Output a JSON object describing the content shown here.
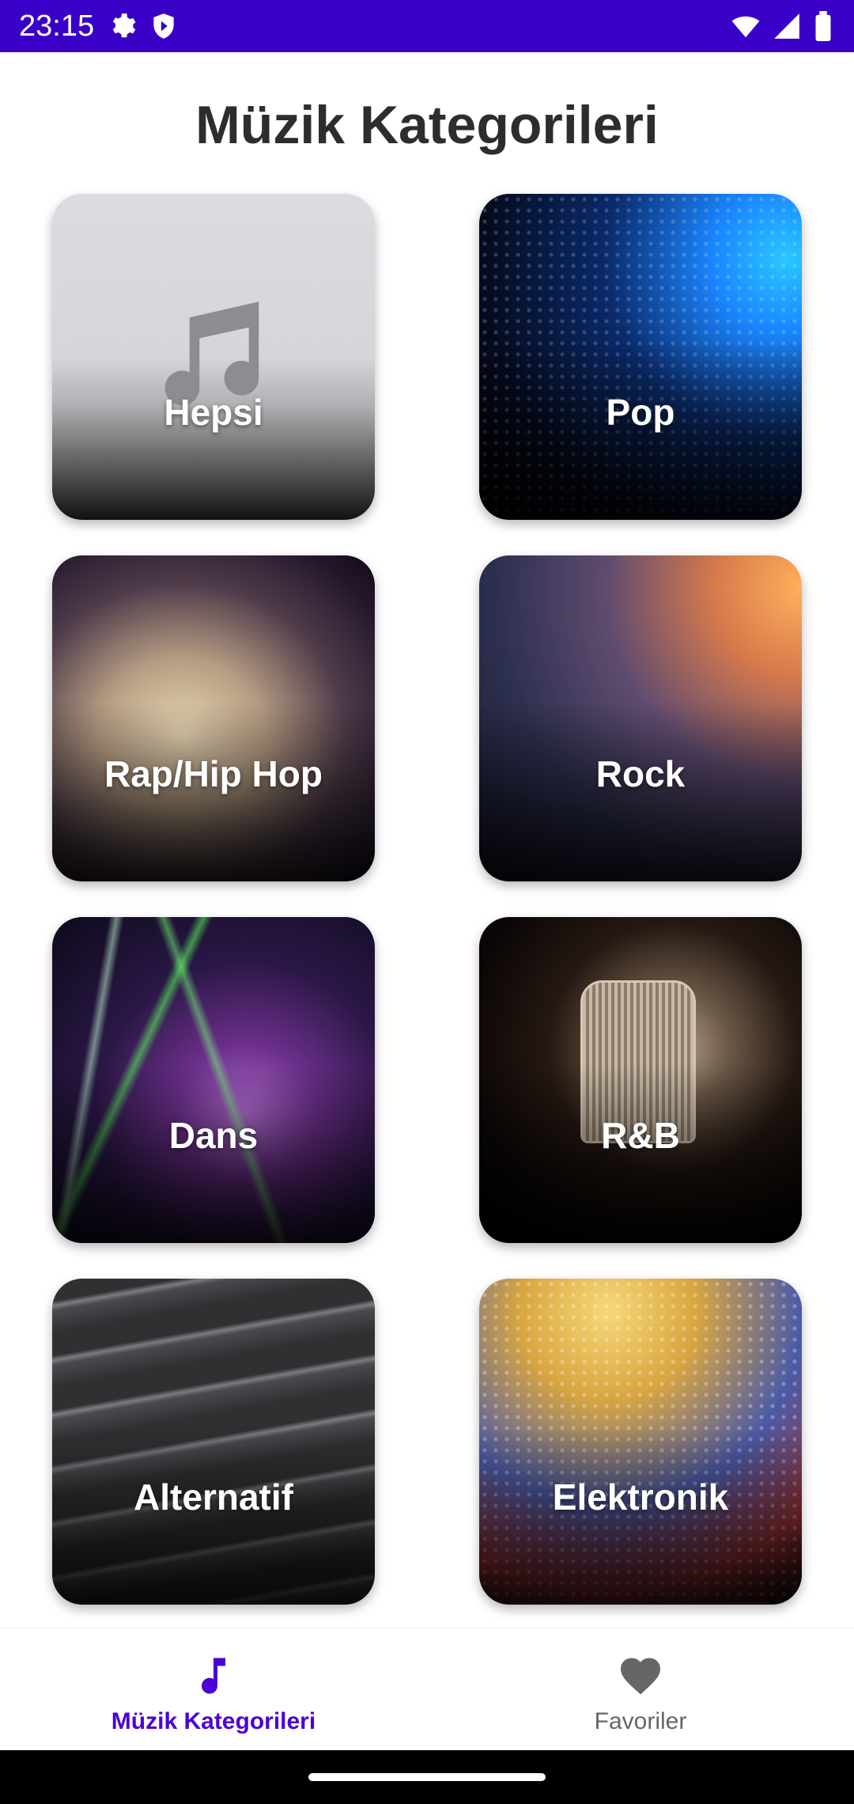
{
  "status_bar": {
    "time": "23:15",
    "left_icons": [
      "settings-icon",
      "shield-icon"
    ],
    "right_icons": [
      "wifi-icon",
      "signal-icon",
      "battery-icon"
    ],
    "color": "#3a00c8"
  },
  "page": {
    "title": "Müzik Kategorileri"
  },
  "categories": [
    {
      "label": "Hepsi"
    },
    {
      "label": "Pop"
    },
    {
      "label": "Rap/Hip Hop"
    },
    {
      "label": "Rock"
    },
    {
      "label": "Dans"
    },
    {
      "label": "R&B"
    },
    {
      "label": "Alternatif"
    },
    {
      "label": "Elektronik"
    }
  ],
  "bottom_nav": {
    "items": [
      {
        "label": "Müzik Kategorileri",
        "icon": "music-note-icon",
        "active": true
      },
      {
        "label": "Favoriler",
        "icon": "heart-icon",
        "active": false
      }
    ],
    "active_color": "#4b00d6"
  }
}
